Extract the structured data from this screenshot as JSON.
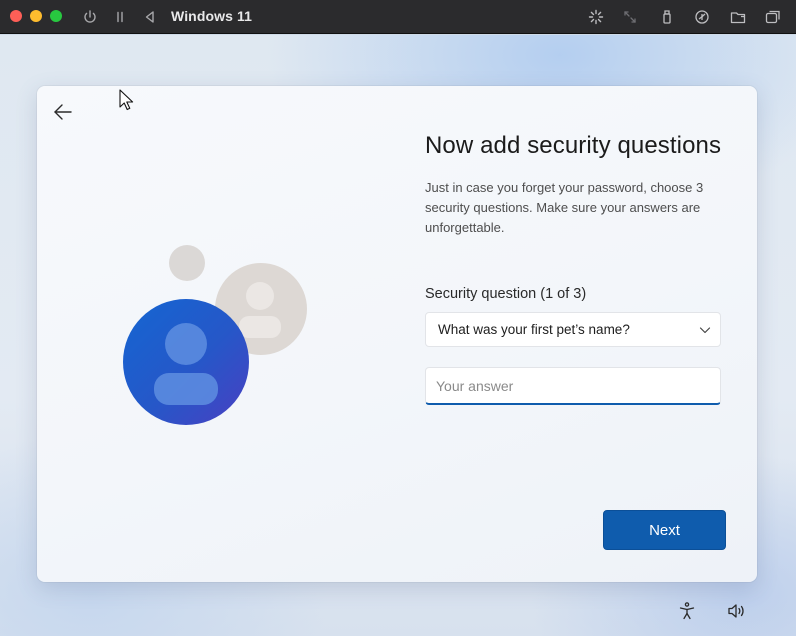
{
  "host": {
    "vm_name": "Windows 11",
    "icons": [
      "power-icon",
      "pause-icon",
      "back-triangle-icon",
      "loading-spinner-icon",
      "resize-icon",
      "usb-icon",
      "network-icon",
      "shared-folder-icon",
      "window-copy-icon"
    ]
  },
  "dialog": {
    "title": "Now add security questions",
    "description": "Just in case you forget your password, choose 3 security questions. Make sure your answers are unforgettable.",
    "question_label": "Security question (1 of 3)",
    "selected_question": "What was your first pet’s name?",
    "answer_value": "",
    "answer_placeholder": "Your answer",
    "next_label": "Next"
  },
  "tray": {
    "icons": [
      "accessibility-icon",
      "volume-icon"
    ]
  },
  "colors": {
    "accent": "#0f5cad",
    "titlebar": "#2b2b2d"
  }
}
